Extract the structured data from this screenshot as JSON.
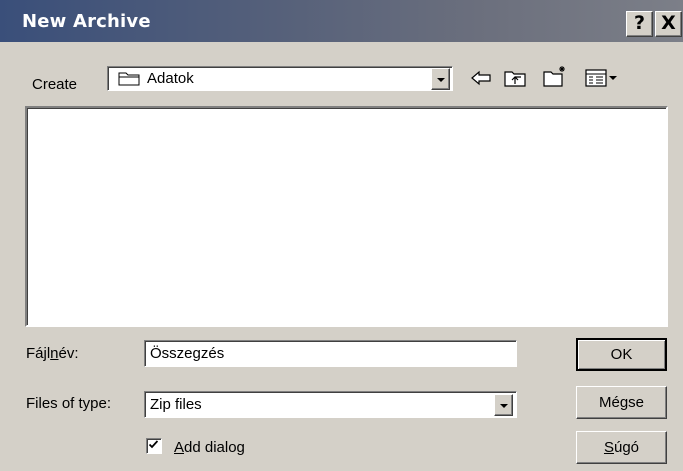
{
  "window": {
    "title": "New Archive"
  },
  "title_buttons": {
    "help": "?",
    "close": "X"
  },
  "location": {
    "label": "Create",
    "current_folder": "Adatok",
    "icon": "folder-icon"
  },
  "toolbar": {
    "back_icon": "back-arrow-icon",
    "up_icon": "up-folder-icon",
    "new_folder_icon": "new-folder-icon",
    "view_icon": "view-menu-icon"
  },
  "file_name": {
    "label_pre": "Fájl",
    "label_ul": "n",
    "label_post": "év:",
    "value": "Összegzés"
  },
  "file_type": {
    "label": "Files of type:",
    "value": "Zip files"
  },
  "buttons": {
    "ok": "OK",
    "cancel": "Mégse",
    "help_ul": "S",
    "help_rest": "úgó"
  },
  "add_dialog": {
    "checked": true,
    "label_ul": "A",
    "label_rest": "dd dialog"
  }
}
